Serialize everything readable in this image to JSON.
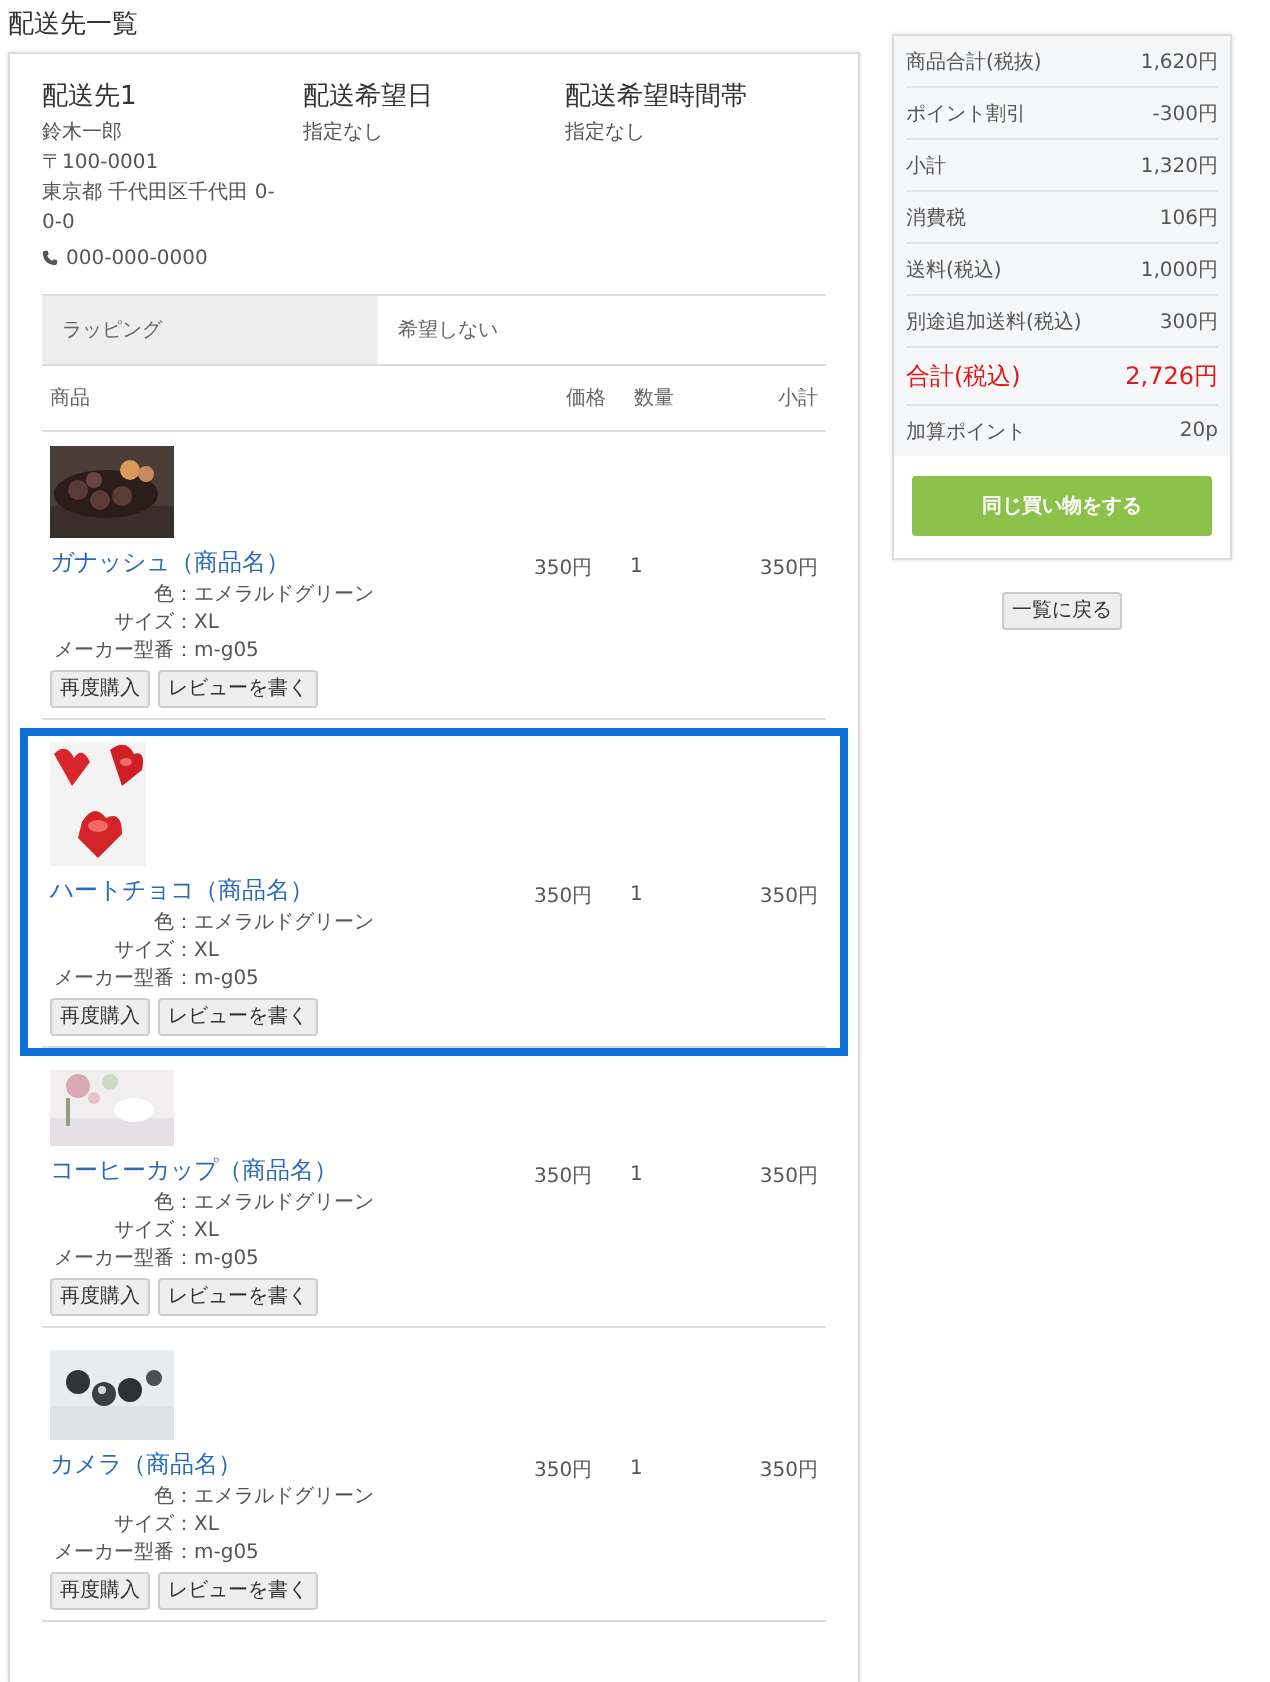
{
  "page_title": "配送先一覧",
  "shipping": {
    "columns": [
      {
        "heading": "配送先1",
        "lines": [
          "鈴木一郎",
          "〒100-0001",
          "東京都 千代田区千代田 0-0-0"
        ],
        "phone": "000-000-0000"
      },
      {
        "heading": "配送希望日",
        "lines": [
          "指定なし"
        ]
      },
      {
        "heading": "配送希望時間帯",
        "lines": [
          "指定なし"
        ]
      }
    ]
  },
  "wrapping": {
    "label": "ラッピング",
    "value": "希望しない"
  },
  "table": {
    "columns": [
      "商品",
      "価格",
      "数量",
      "小計"
    ],
    "rows": [
      {
        "name": "ガナッシュ（商品名）",
        "price": "350円",
        "qty": "1",
        "subtotal": "350円",
        "highlighted": false,
        "details": [
          {
            "label": "色：",
            "value": "エメラルドグリーン"
          },
          {
            "label": "サイズ：",
            "value": "XL"
          },
          {
            "label": "メーカー型番：",
            "value": "m-g05"
          }
        ],
        "buttons": [
          "再度購入",
          "レビューを書く"
        ]
      },
      {
        "name": "ハートチョコ（商品名）",
        "price": "350円",
        "qty": "1",
        "subtotal": "350円",
        "highlighted": true,
        "details": [
          {
            "label": "色：",
            "value": "エメラルドグリーン"
          },
          {
            "label": "サイズ：",
            "value": "XL"
          },
          {
            "label": "メーカー型番：",
            "value": "m-g05"
          }
        ],
        "buttons": [
          "再度購入",
          "レビューを書く"
        ]
      },
      {
        "name": "コーヒーカップ（商品名）",
        "price": "350円",
        "qty": "1",
        "subtotal": "350円",
        "highlighted": false,
        "details": [
          {
            "label": "色：",
            "value": "エメラルドグリーン"
          },
          {
            "label": "サイズ：",
            "value": "XL"
          },
          {
            "label": "メーカー型番：",
            "value": "m-g05"
          }
        ],
        "buttons": [
          "再度購入",
          "レビューを書く"
        ]
      },
      {
        "name": "カメラ（商品名）",
        "price": "350円",
        "qty": "1",
        "subtotal": "350円",
        "highlighted": false,
        "details": [
          {
            "label": "色：",
            "value": "エメラルドグリーン"
          },
          {
            "label": "サイズ：",
            "value": "XL"
          },
          {
            "label": "メーカー型番：",
            "value": "m-g05"
          }
        ],
        "buttons": [
          "再度購入",
          "レビューを書く"
        ]
      }
    ]
  },
  "summary": {
    "rows": [
      {
        "label": "商品合計(税抜)",
        "value": "1,620円",
        "kind": "normal"
      },
      {
        "label": "ポイント割引",
        "value": "-300円",
        "kind": "normal"
      },
      {
        "label": "小計",
        "value": "1,320円",
        "kind": "normal"
      },
      {
        "label": "消費税",
        "value": "106円",
        "kind": "normal"
      },
      {
        "label": "送料(税込)",
        "value": "1,000円",
        "kind": "normal"
      },
      {
        "label": "別途追加送料(税込)",
        "value": "300円",
        "kind": "normal"
      },
      {
        "label": "合計(税込)",
        "value": "2,726円",
        "kind": "total"
      },
      {
        "label": "加算ポイント",
        "value": "20p",
        "kind": "normal"
      }
    ],
    "button": "同じ買い物をする"
  },
  "back_button": "一覧に戻る"
}
